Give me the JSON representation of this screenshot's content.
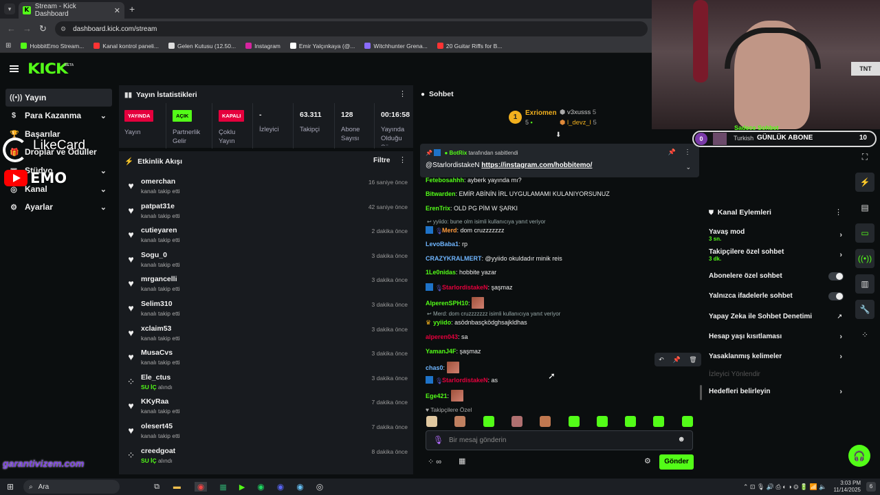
{
  "browser": {
    "tab_title": "Stream - Kick Dashboard",
    "url": "dashboard.kick.com/stream",
    "bookmarks": [
      {
        "label": "HobbitEmo Stream...",
        "color": "#53fc18"
      },
      {
        "label": "Kanal kontrol paneli...",
        "color": "#ff3333"
      },
      {
        "label": "Gelen Kutusu (12.50...",
        "color": "#ddd"
      },
      {
        "label": "Instagram",
        "color": "#d6249f"
      },
      {
        "label": "Emir Yalçınkaya (@...",
        "color": "#fff"
      },
      {
        "label": "Witchhunter Grena...",
        "color": "#8a6cff"
      },
      {
        "label": "20 Guitar Riffs for B...",
        "color": "#ff3333"
      }
    ]
  },
  "header": {
    "logo": "KICK",
    "beta": "BETA"
  },
  "nav": [
    {
      "label": "Yayın",
      "icon": "broadcast-icon",
      "glyph": "((•))",
      "active": true,
      "chevron": false
    },
    {
      "label": "Para Kazanma",
      "icon": "money-icon",
      "glyph": "$",
      "active": false,
      "chevron": true
    },
    {
      "label": "Başarılar",
      "icon": "trophy-icon",
      "glyph": "🏆",
      "active": false,
      "chevron": false
    },
    {
      "label": "Droplar ve Ödüller",
      "icon": "gift-icon",
      "glyph": "🎁",
      "active": false,
      "chevron": false
    },
    {
      "label": "Stüdyo",
      "icon": "studio-icon",
      "glyph": "▣",
      "active": false,
      "chevron": true
    },
    {
      "label": "Kanal",
      "icon": "channel-icon",
      "glyph": "◎",
      "active": false,
      "chevron": true
    },
    {
      "label": "Ayarlar",
      "icon": "gear-icon",
      "glyph": "⚙",
      "active": false,
      "chevron": true
    }
  ],
  "overlays": {
    "likecard": "LikeCard",
    "emo": "EMO",
    "garanti": "garantivizem.com"
  },
  "stats": {
    "title": "Yayın İstatistikleri",
    "columns": [
      {
        "badge": "YAYINDA",
        "badge_bg": "#e5003d",
        "badge_fg": "#fff",
        "label": "Yayın"
      },
      {
        "badge": "AÇIK",
        "badge_bg": "#53fc18",
        "badge_fg": "#000",
        "label": "Partnerlik Gelir"
      },
      {
        "badge": "KAPALI",
        "badge_bg": "#e5003d",
        "badge_fg": "#fff",
        "label": "Çoklu Yayın"
      },
      {
        "value": "-",
        "label": "İzleyici"
      },
      {
        "value": "63.311",
        "label": "Takipçi"
      },
      {
        "value": "128",
        "label": "Abone Sayısı"
      },
      {
        "value": "00:16:58",
        "label": "Yayında Olduğu Süre"
      }
    ]
  },
  "activity": {
    "title": "Etkinlik Akışı",
    "filter": "Filtre",
    "items": [
      {
        "name": "omerchan",
        "sub": "kanalı takip etti",
        "time": "16 saniye önce",
        "type": "follow"
      },
      {
        "name": "patpat31e",
        "sub": "kanalı takip etti",
        "time": "42 saniye önce",
        "type": "follow"
      },
      {
        "name": "cutieyaren",
        "sub": "kanalı takip etti",
        "time": "2 dakika önce",
        "type": "follow"
      },
      {
        "name": "Sogu_0",
        "sub": "kanalı takip etti",
        "time": "3 dakika önce",
        "type": "follow"
      },
      {
        "name": "mrgancelli",
        "sub": "kanalı takip etti",
        "time": "3 dakika önce",
        "type": "follow"
      },
      {
        "name": "Selim310",
        "sub": "kanalı takip etti",
        "time": "3 dakika önce",
        "type": "follow"
      },
      {
        "name": "xclaim53",
        "sub": "kanalı takip etti",
        "time": "3 dakika önce",
        "type": "follow"
      },
      {
        "name": "MusaCvs",
        "sub": "kanalı takip etti",
        "time": "3 dakika önce",
        "type": "follow"
      },
      {
        "name": "Ele_ctus",
        "sub": "SU İÇ",
        "sub2": "alındı",
        "time": "3 dakika önce",
        "type": "reward"
      },
      {
        "name": "KKyRaa",
        "sub": "kanalı takip etti",
        "time": "7 dakika önce",
        "type": "follow"
      },
      {
        "name": "olesert45",
        "sub": "kanalı takip etti",
        "time": "7 dakika önce",
        "type": "follow"
      },
      {
        "name": "creedgoat",
        "sub": "SU İÇ",
        "sub2": "alındı",
        "time": "8 dakika önce",
        "type": "reward"
      }
    ]
  },
  "chat": {
    "title": "Sohbet",
    "top_gifter": {
      "rank": "1",
      "name": "Exriomen",
      "count": "5"
    },
    "gifters": [
      {
        "name": "v3xusss",
        "count": "5"
      },
      {
        "name": "l_devz_l",
        "count": "5"
      }
    ],
    "pinned": {
      "by": "BotRix",
      "by_suffix": "tarafından sabitlendi",
      "user": "@StarlordistakeN",
      "link": "https://instagram.com/hobbitemo/"
    },
    "messages": [
      {
        "user": "Fetebosahhh",
        "color": "#53fc18",
        "text": "ayberk yayında mı?"
      },
      {
        "user": "Bitwarden",
        "color": "#53fc18",
        "text": "EMİR ABİNİN İRL UYGULAMAMI KULANIYORSUNUZ"
      },
      {
        "user": "ErenTrix",
        "color": "#53fc18",
        "text": "OLD PG PİM W ŞARKI"
      },
      {
        "reply": "yyiido: bune olm isimli kullanıcıya yanıt veriyor"
      },
      {
        "user": "Merd",
        "color": "#ff9a3d",
        "text": "dom cruzzzzzzz",
        "badges": true
      },
      {
        "user": "LevoBaba1",
        "color": "#6fb6ff",
        "text": "rp"
      },
      {
        "user": "CRAZYKRALMERT",
        "color": "#6fb6ff",
        "text": "@yyiido okuldadır minik reis"
      },
      {
        "user": "1Le0nidas",
        "color": "#53fc18",
        "text": "hobbite yazar"
      },
      {
        "user": "StarlordistakeN",
        "color": "#e5003d",
        "text": "şaşmaz",
        "badges": true
      },
      {
        "user": "AlperenSPH10",
        "color": "#53fc18",
        "text": "",
        "emote": true
      },
      {
        "reply": "Merd: dom cruzzzzzzz isimli kullanıcıya yanıt veriyor"
      },
      {
        "user": "yyiido",
        "color": "#53fc18",
        "text": "asödnbasçködghsajkldhas",
        "crown": true
      },
      {
        "user": "alperen043",
        "color": "#e5003d",
        "text": "sa"
      },
      {
        "user": "YamanJ4F",
        "color": "#53fc18",
        "text": "şaşmaz"
      },
      {
        "user": "chas0",
        "color": "#6fb6ff",
        "text": "",
        "emote": true
      },
      {
        "user": "StarlordistakeN",
        "color": "#e5003d",
        "text": "as",
        "badges": true
      },
      {
        "user": "Ege421",
        "color": "#53fc18",
        "text": "",
        "emote": true
      }
    ],
    "followers_only": "Takipçilere Özel",
    "input_placeholder": "Bir mesaj gönderin",
    "send": "Gönder"
  },
  "goal": {
    "num": "0",
    "language": "Turkish",
    "text": "GÜNLÜK ABONE",
    "target": "10",
    "above": "Sadece Sohbet"
  },
  "channel_actions": {
    "title": "Kanal Eylemleri",
    "items": [
      {
        "label": "Yavaş mod",
        "sub": "3 sn.",
        "control": "chevron"
      },
      {
        "label": "Takipçilere özel sohbet",
        "sub": "3 dk.",
        "control": "chevron"
      },
      {
        "label": "Abonelere özel sohbet",
        "control": "toggle"
      },
      {
        "label": "Yalnızca ifadelerle sohbet",
        "control": "toggle"
      },
      {
        "label": "Yapay Zeka ile Sohbet Denetimi",
        "control": "external"
      },
      {
        "label": "Hesap yaşı kısıtlaması",
        "control": "chevron"
      },
      {
        "label": "Yasaklanmış kelimeler",
        "control": "chevron"
      },
      {
        "label": "İzleyici Yönlendir",
        "control": "none",
        "disabled": true
      },
      {
        "label": "Hedefleri belirleyin",
        "control": "chevron"
      }
    ]
  },
  "taskbar": {
    "search": "Ara",
    "time": "3:03 PM",
    "date": "11/14/2025",
    "notif": "6"
  },
  "colors": {
    "accent": "#53fc18",
    "bg": "#0b0e0f",
    "panel": "#181b1f",
    "live": "#e5003d"
  }
}
